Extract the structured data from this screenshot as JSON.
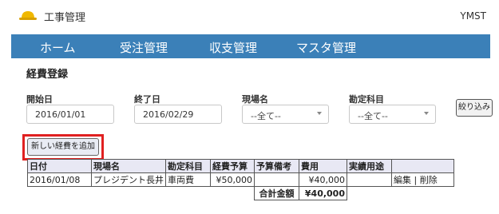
{
  "app": {
    "title": "工事管理",
    "user": "YMST"
  },
  "nav": {
    "items": [
      "ホーム",
      "受注管理",
      "収支管理",
      "マスタ管理"
    ]
  },
  "page": {
    "title": "経費登録"
  },
  "filters": {
    "start_label": "開始日",
    "start_value": "2016/01/01",
    "end_label": "終了日",
    "end_value": "2016/02/29",
    "site_label": "現場名",
    "site_value": "--全て--",
    "account_label": "勘定科目",
    "account_value": "--全て--",
    "filter_button": "絞り込み"
  },
  "add_button": "新しい経費を追加",
  "table": {
    "headers": [
      "日付",
      "現場名",
      "勘定科目",
      "経費予算",
      "予算備考",
      "費用",
      "実績用途",
      ""
    ],
    "rows": [
      {
        "date": "2016/01/08",
        "site": "プレジデント長井",
        "account": "車両費",
        "budget": "¥50,000",
        "budget_note": "",
        "cost": "¥40,000",
        "usage": "",
        "edit": "編集",
        "sep": "|",
        "delete": "削除"
      }
    ],
    "total_label": "合計金額",
    "total_value": "¥40,000"
  },
  "colors": {
    "nav_bg": "#3b80b8",
    "highlight": "#e02020",
    "header_bg": "#e8e8f4"
  }
}
